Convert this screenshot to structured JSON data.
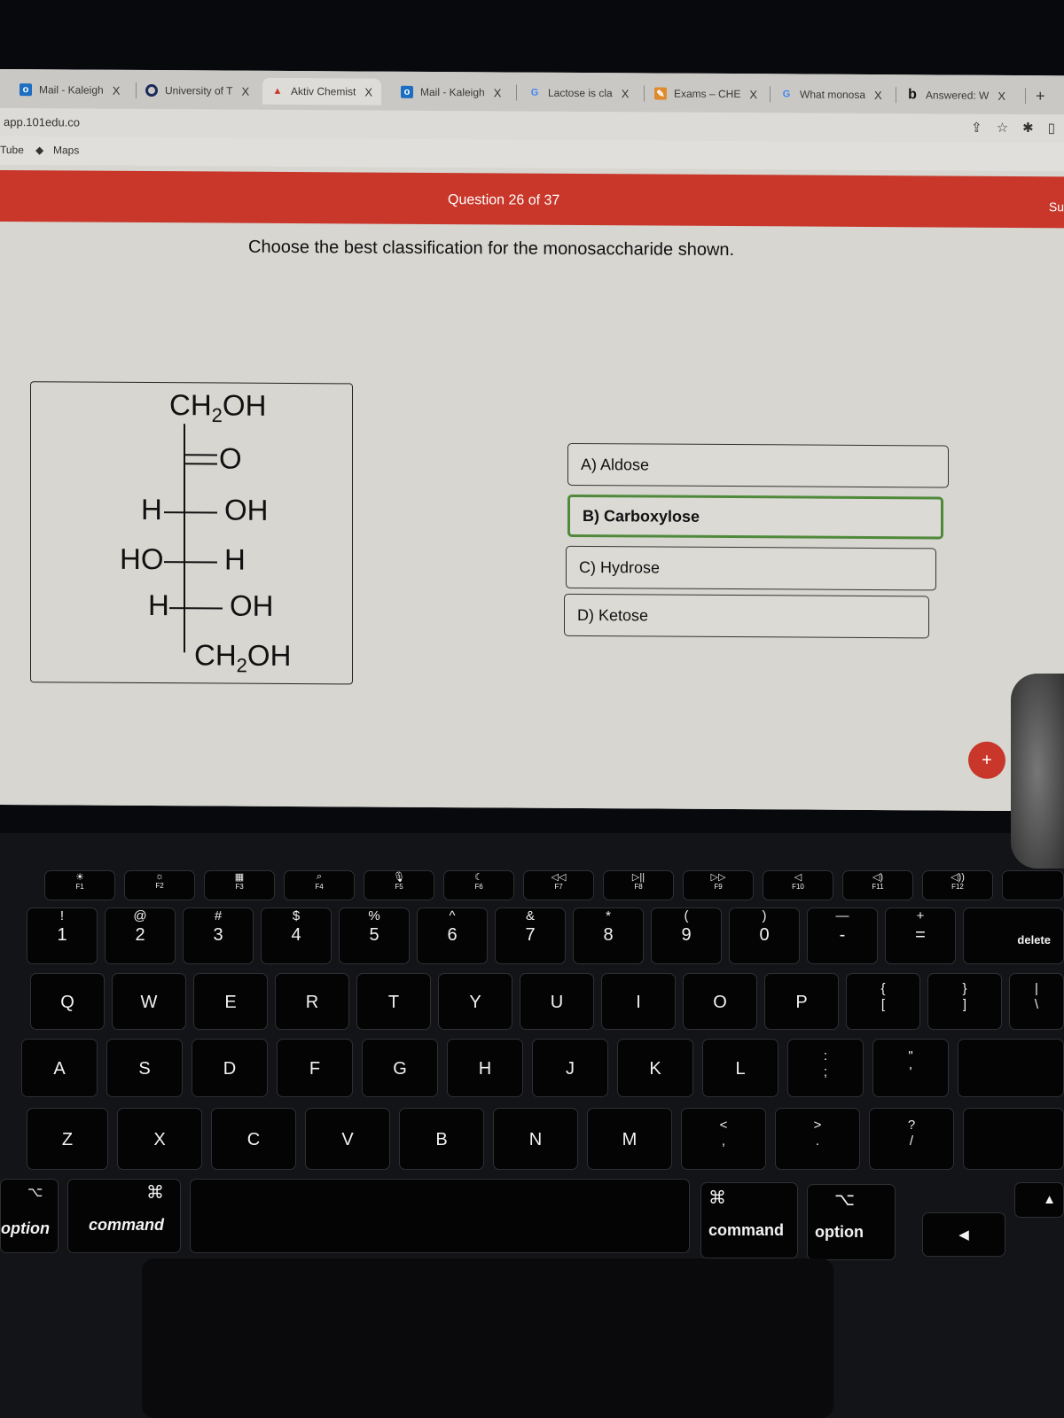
{
  "browser": {
    "tabs": [
      {
        "label": "Mail - Kaleigh",
        "icon": "outlook-icon",
        "active": false
      },
      {
        "label": "University of T",
        "icon": "university-icon",
        "active": false
      },
      {
        "label": "Aktiv Chemist",
        "icon": "aktiv-icon",
        "active": true
      },
      {
        "label": "Mail - Kaleigh",
        "icon": "outlook-icon",
        "active": false
      },
      {
        "label": "Lactose is cla",
        "icon": "google-icon",
        "active": false
      },
      {
        "label": "Exams – CHE",
        "icon": "exams-icon",
        "active": false
      },
      {
        "label": "What monosa",
        "icon": "google-icon",
        "active": false
      },
      {
        "label": "Answered: W",
        "icon": "bartleby-icon",
        "active": false
      }
    ],
    "close_glyph": "X",
    "new_tab": "+",
    "url": "app.101edu.co",
    "bookmarks": [
      {
        "label": "Tube"
      },
      {
        "label": "Maps"
      }
    ],
    "toolbar_icons": [
      "share-icon",
      "star-icon",
      "extensions-icon",
      "sidepanel-icon"
    ]
  },
  "quiz": {
    "progress": "Question 26 of 37",
    "submit_partial": "Su",
    "prompt": "Choose the best classification for the monosaccharide shown.",
    "molecule": {
      "top": "CH2OH",
      "carbonyl": "O",
      "rows": [
        {
          "left": "H",
          "right": "OH"
        },
        {
          "left": "HO",
          "right": "H"
        },
        {
          "left": "H",
          "right": "OH"
        }
      ],
      "bottom": "CH2OH"
    },
    "options": [
      {
        "label": "A) Aldose",
        "selected": false
      },
      {
        "label": "B) Carboxylose",
        "selected": true
      },
      {
        "label": "C) Hydrose",
        "selected": false
      },
      {
        "label": "D) Ketose",
        "selected": false
      }
    ],
    "fab": "+"
  },
  "keyboard": {
    "fn_row": [
      {
        "glyph": "☀",
        "label": "F1"
      },
      {
        "glyph": "☼",
        "label": "F2"
      },
      {
        "glyph": "▦",
        "label": "F3"
      },
      {
        "glyph": "⌕",
        "label": "F4"
      },
      {
        "glyph": "🎙",
        "label": "F5"
      },
      {
        "glyph": "☾",
        "label": "F6"
      },
      {
        "glyph": "◁◁",
        "label": "F7"
      },
      {
        "glyph": "▷||",
        "label": "F8"
      },
      {
        "glyph": "▷▷",
        "label": "F9"
      },
      {
        "glyph": "◁",
        "label": "F10"
      },
      {
        "glyph": "◁)",
        "label": "F11"
      },
      {
        "glyph": "◁))",
        "label": "F12"
      }
    ],
    "num_row": [
      {
        "top": "!",
        "bottom": "1"
      },
      {
        "top": "@",
        "bottom": "2"
      },
      {
        "top": "#",
        "bottom": "3"
      },
      {
        "top": "$",
        "bottom": "4"
      },
      {
        "top": "%",
        "bottom": "5"
      },
      {
        "top": "^",
        "bottom": "6"
      },
      {
        "top": "&",
        "bottom": "7"
      },
      {
        "top": "*",
        "bottom": "8"
      },
      {
        "top": "(",
        "bottom": "9"
      },
      {
        "top": ")",
        "bottom": "0"
      },
      {
        "top": "—",
        "bottom": "-"
      },
      {
        "top": "+",
        "bottom": "="
      }
    ],
    "delete": "delete",
    "q_row": [
      "Q",
      "W",
      "E",
      "R",
      "T",
      "Y",
      "U",
      "I",
      "O",
      "P"
    ],
    "q_row_extra": [
      {
        "top": "{",
        "bottom": "["
      },
      {
        "top": "}",
        "bottom": "]"
      },
      {
        "top": "|",
        "bottom": "\\"
      }
    ],
    "a_row": [
      "A",
      "S",
      "D",
      "F",
      "G",
      "H",
      "J",
      "K",
      "L"
    ],
    "a_row_extra": [
      {
        "top": ":",
        "bottom": ";"
      },
      {
        "top": "\"",
        "bottom": "'"
      }
    ],
    "z_row": [
      "Z",
      "X",
      "C",
      "V",
      "B",
      "N",
      "M"
    ],
    "z_row_extra": [
      {
        "top": "<",
        "bottom": ","
      },
      {
        "top": ">",
        "bottom": "."
      },
      {
        "top": "?",
        "bottom": "/"
      }
    ],
    "bottom_row": {
      "left_option_glyph": "⌥",
      "left_option": "option",
      "left_command_glyph": "⌘",
      "left_command": "command",
      "right_command_glyph": "⌘",
      "right_command": "command",
      "right_option_glyph": "⌥",
      "right_option": "option",
      "arrow_left": "◀",
      "arrow_up": "▲"
    }
  }
}
